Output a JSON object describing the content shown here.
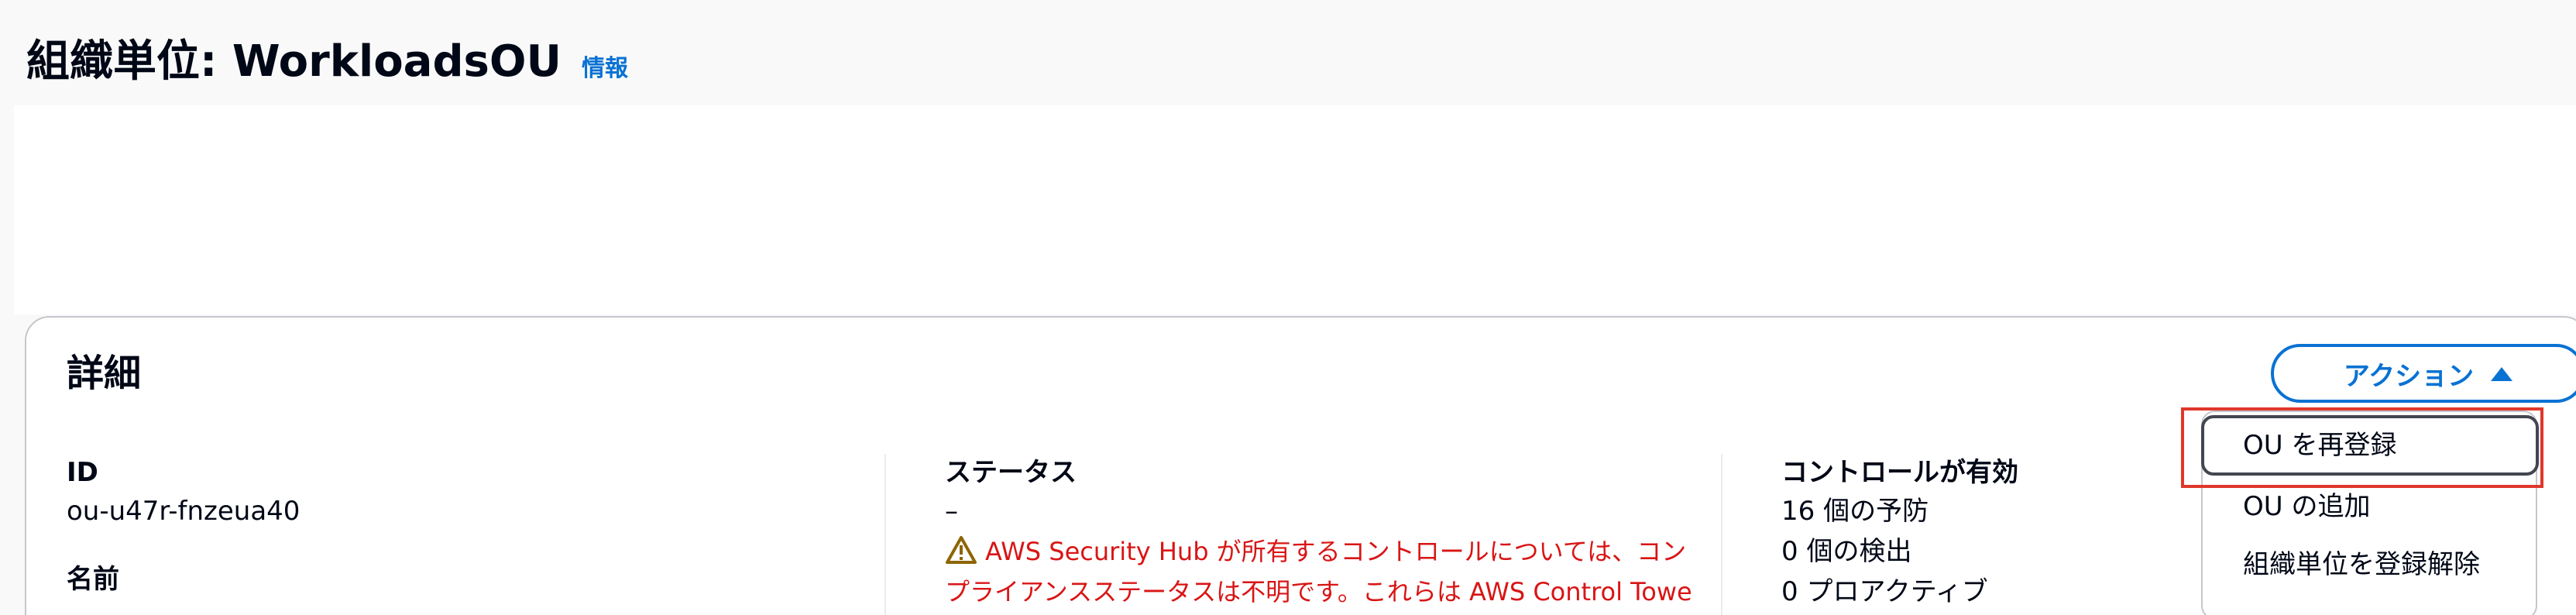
{
  "header": {
    "title": "組織単位: WorkloadsOU",
    "info_link": "情報"
  },
  "details": {
    "title": "詳細",
    "action_button": "アクション",
    "columns": {
      "left": {
        "id_label": "ID",
        "id_value": "ou-u47r-fnzeua40",
        "name_label": "名前"
      },
      "middle": {
        "status_label": "ステータス",
        "status_value": "–",
        "warning_line1": "AWS Security Hub が所有するコントロールについては、コン",
        "warning_line2": "プライアンスステータスは不明です。これらは AWS Control Towe"
      },
      "right": {
        "controls_label": "コントロールが有効",
        "preventive": "16 個の予防",
        "detective": "0 個の検出",
        "proactive": "0 プロアクティブ"
      }
    }
  },
  "action_menu": {
    "items": [
      {
        "label": "OU を再登録",
        "focused": true
      },
      {
        "label": "OU の追加",
        "focused": false
      },
      {
        "label": "組織単位を登録解除",
        "focused": false
      }
    ]
  },
  "colors": {
    "accent": "#0972d3",
    "warning_text": "#d91515",
    "warning_icon": "#8d6605",
    "highlight": "#e0372b"
  },
  "icons": {
    "warning": "warning-triangle-icon",
    "caret": "caret-up-icon"
  }
}
